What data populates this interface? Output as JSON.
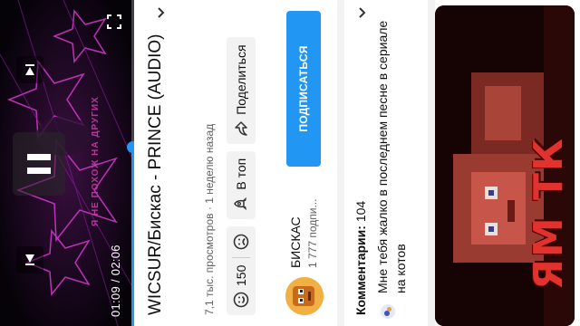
{
  "player": {
    "current_time": "01:09",
    "separator": " / ",
    "duration": "02:06",
    "progress": 0.5476,
    "overlay_text": "Я НЕ ПОХОЖ НА ДРУГИХ",
    "controls": [
      "previous-icon",
      "pause-icon",
      "next-icon",
      "fullscreen-icon"
    ],
    "accent_color": "#2196f3"
  },
  "video": {
    "title": "WICSUR/Бискас - PRINCE (AUDIO)",
    "views": "7,1 тыс. просмотров",
    "meta_separator": " · ",
    "uploaded": "1 неделю назад"
  },
  "actions": {
    "like_count": "150",
    "like_icon": "smile-icon",
    "dislike_icon": "frown-icon",
    "top_label": "В топ",
    "top_icon": "rocket-icon",
    "share_label": "Поделиться",
    "share_icon": "share-icon"
  },
  "channel": {
    "name": "БИСКАС",
    "subscribers": "1 777 подпи...",
    "subscribe_label": "ПОДПИСАТЬСЯ"
  },
  "comments": {
    "header": "Комментарии:",
    "count": "104",
    "top_comment": "Мне тебя жалко в последнем песне в сериале на котов"
  },
  "next_video": {
    "thumb_text": "ЯМ ТК"
  }
}
